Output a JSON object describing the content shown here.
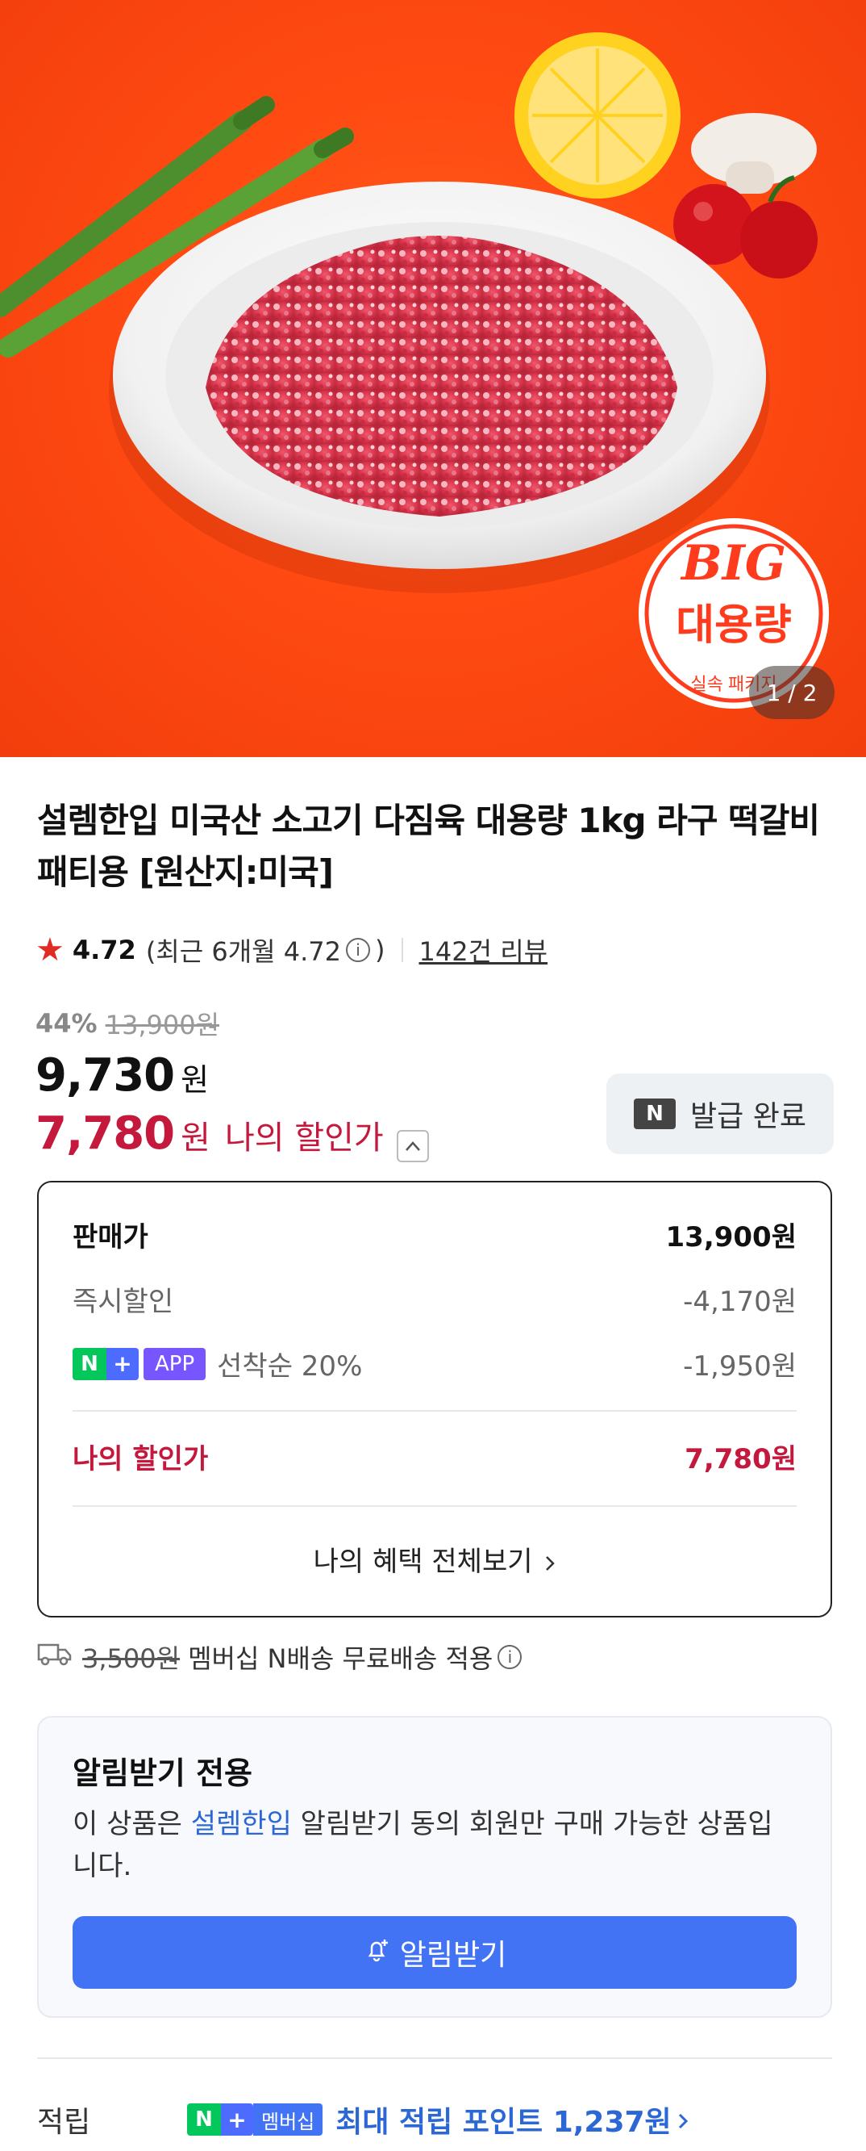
{
  "gallery": {
    "counter": "1 / 2",
    "sticker_big": "BIG",
    "sticker_main": "대용량",
    "sticker_sub": "실속 패키지"
  },
  "product": {
    "title": "설렘한입 미국산 소고기 다짐육 대용량 1kg 라구 떡갈비 패티용 [원산지:미국]"
  },
  "rating": {
    "score": "4.72",
    "recent_text": "(최근 6개월 4.72",
    "recent_close": ")",
    "review_link": "142건 리뷰",
    "info_icon": "i"
  },
  "pricing": {
    "discount_pct": "44%",
    "original_price": "13,900원",
    "sale_price": "9,730",
    "won": "원",
    "my_price": "7,780",
    "my_price_label": "나의 할인가",
    "coupon_badge": "N",
    "coupon_label": "발급 완료"
  },
  "breakdown": {
    "rows": [
      {
        "label": "판매가",
        "value": "13,900원"
      },
      {
        "label": "즉시할인",
        "value": "-4,170원"
      },
      {
        "label": "선착순 20%",
        "value": "-1,950원"
      }
    ],
    "badge_n": "N",
    "badge_plus": "+",
    "badge_app": "APP",
    "total_label": "나의 할인가",
    "total_value": "7,780원",
    "benefits_link": "나의 혜택 전체보기"
  },
  "shipping": {
    "original_fee": "3,500원",
    "text": "멤버십 N배송 무료배송 적용"
  },
  "alert": {
    "title": "알림받기 전용",
    "desc_prefix": "이 상품은 ",
    "seller": "설렘한입",
    "desc_suffix": " 알림받기 동의 회원만 구매 가능한 상품입니다.",
    "button": "알림받기"
  },
  "points": {
    "label": "적립",
    "badge_member": "멤버십",
    "text": "최대 적립 포인트 1,237원"
  },
  "colors": {
    "accent_red": "#c4183c",
    "link_blue": "#2c67d6",
    "button_blue": "#4373f5",
    "naver_green": "#03c75a"
  }
}
